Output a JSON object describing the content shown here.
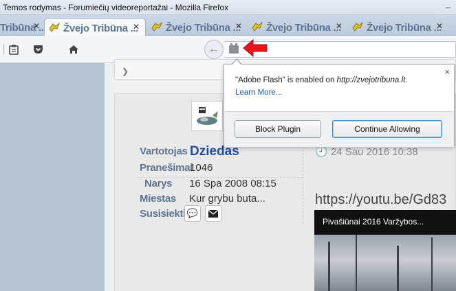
{
  "window": {
    "title": "Temos rodymas - Forumiečių videoreportažai - Mozilla Firefox",
    "minimize_glyph": "–"
  },
  "tabs": [
    {
      "label": "Tribūna ...",
      "active": false
    },
    {
      "label": "Žvejo Tribūna ...",
      "active": true
    },
    {
      "label": "Žvejo Tribūna ...",
      "active": false
    },
    {
      "label": "Žvejo Tribūna ...",
      "active": false
    },
    {
      "label": "Žvejo Tribūna ...",
      "active": false
    }
  ],
  "toolbar": {
    "icons": [
      "clipboard-icon",
      "pocket-icon",
      "home-icon"
    ],
    "back_glyph": "←"
  },
  "popup": {
    "message_prefix": "\"Adobe Flash\" is enabled on ",
    "message_site": "http://zvejotribuna.lt",
    "message_suffix": ".",
    "learn_more": "Learn More...",
    "block_button": "Block Plugin",
    "continue_button": "Continue Allowing",
    "close_glyph": "×"
  },
  "post": {
    "labels": {
      "user": "Vartotojas",
      "posts": "Pranešimai",
      "member": "Narys",
      "city": "Miestas",
      "contact": "Susisiekti"
    },
    "username": "Dziedas",
    "posts_count": "1046",
    "member_since": "16 Spa 2008 08:15",
    "city": "Kur grybu buta...",
    "date": "24 Sau 2016 10:38",
    "url_text": "https://youtu.be/Gd83",
    "video_title": "Pivašiūnai 2016 Varžybos..."
  },
  "colors": {
    "label": "#5f7690",
    "username": "#1f4aa7",
    "link": "#1a5db8",
    "red_arrow": "#e8141b"
  }
}
